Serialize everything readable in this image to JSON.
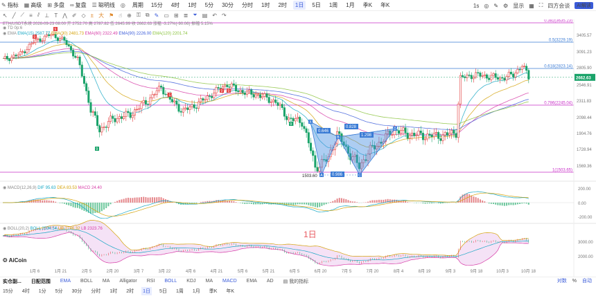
{
  "topbar": {
    "items": [
      {
        "icon": "indicator-icon",
        "label": "指标"
      },
      {
        "icon": "pro-icon",
        "label": "高级"
      },
      {
        "icon": "multi-icon",
        "label": "多盘"
      },
      {
        "icon": "replay-icon",
        "label": "复盘"
      },
      {
        "icon": "smart-icon",
        "label": "聪明线"
      },
      {
        "icon": "glasses-icon",
        "label": ""
      }
    ],
    "period_label": "周期",
    "periods": [
      "15分",
      "4时",
      "1时",
      "5分",
      "30分",
      "分时",
      "1时",
      "2时",
      "1日",
      "5日",
      "1周",
      "1月",
      "季K",
      "年K"
    ],
    "active_period": "1日",
    "right": [
      "1s",
      "显示"
    ],
    "account": "四方会谈",
    "ai_badge": "AI解读"
  },
  "info": {
    "symbol_line": "ETH/USDT永续  2026-09-23 08:00  开 2752.70  高 2787.82  低 2645.99  收 2662.63  涨幅 -3.27%(-90.06)  振幅 5.15%",
    "td_line": "TD  0p:6",
    "ema_line": [
      "EMA",
      "EMA(15) 2587.77",
      "EMA(30) 2481.73",
      "EMA(60) 2322.49",
      "EMA(90) 2226.00",
      "EMA(120) 2201.74"
    ],
    "macd_line": [
      "MACD(12,26,9)",
      "DIF 95.63",
      "DEA 83.53",
      "MACD 24.40"
    ],
    "boll_line": [
      "BOLL(20,2)",
      "BOLL 2534.54",
      "UB 2746.32",
      "LB 2323.76"
    ]
  },
  "fib_levels": [
    {
      "label": "0.382(3635.23)",
      "color": "#c82fc8"
    },
    {
      "label": "0.5(3229.19)",
      "color": "#3a7bd5"
    },
    {
      "label": "0.618(2823.14)",
      "color": "#3a7bd5"
    },
    {
      "label": "0.786(2245.04)",
      "color": "#c82fc8"
    },
    {
      "label": "1(1503.65)",
      "color": "#c82fc8"
    }
  ],
  "price_axis": [
    "3405.57",
    "3091.23",
    "2805.90",
    "2546.91",
    "2311.83",
    "2098.44",
    "1904.76",
    "1728.94",
    "1569.36"
  ],
  "last_price": "2662.63",
  "macd_axis": [
    "200.00",
    "0.00",
    "-200.00"
  ],
  "boll_axis": [
    "3000.00",
    "2000.00"
  ],
  "x_axis": [
    "1月 6",
    "1月 21",
    "2月 5",
    "2月 20",
    "3月 7",
    "3月 22",
    "4月 6",
    "4月 21",
    "5月 6",
    "5月 21",
    "6月 5",
    "6月 20",
    "7月 5",
    "7月 20",
    "8月 4",
    "8月 19",
    "9月 3",
    "9月 18",
    "10月 3",
    "10月 18"
  ],
  "x_axis_right": "10月 18 日",
  "pattern_labels": {
    "X": "X",
    "A": "A",
    "B": "B",
    "C": "C",
    "D": "D",
    "r1": "0.646",
    "r2": "1.298",
    "r3": "0.828",
    "r4": "0.986",
    "low_price": "1503.60"
  },
  "td_marks": [
    "9",
    "9",
    "9",
    "13",
    "9",
    "9",
    "9"
  ],
  "watermark": "1日",
  "logo": "AiCoin",
  "bottom1": {
    "left": [
      "实仓副...",
      "日配范围"
    ],
    "indicators": [
      "EMA",
      "BOLL",
      "MA",
      "Alligator",
      "RSI",
      "BOLL",
      "KDJ",
      "MA",
      "MACD",
      "EMA",
      "AD"
    ],
    "extra": "我的指标",
    "right": [
      "对数",
      "%",
      "自动"
    ]
  },
  "bottom2": {
    "periods": [
      "15分",
      "4时",
      "1分",
      "5分",
      "30分",
      "分时",
      "1时",
      "2时",
      "1日",
      "5日",
      "1周",
      "1月",
      "季K",
      "年K"
    ],
    "active": "1日"
  },
  "colors": {
    "up": "#e23b3b",
    "down": "#1aa36a",
    "accent": "#3a5bd9"
  }
}
